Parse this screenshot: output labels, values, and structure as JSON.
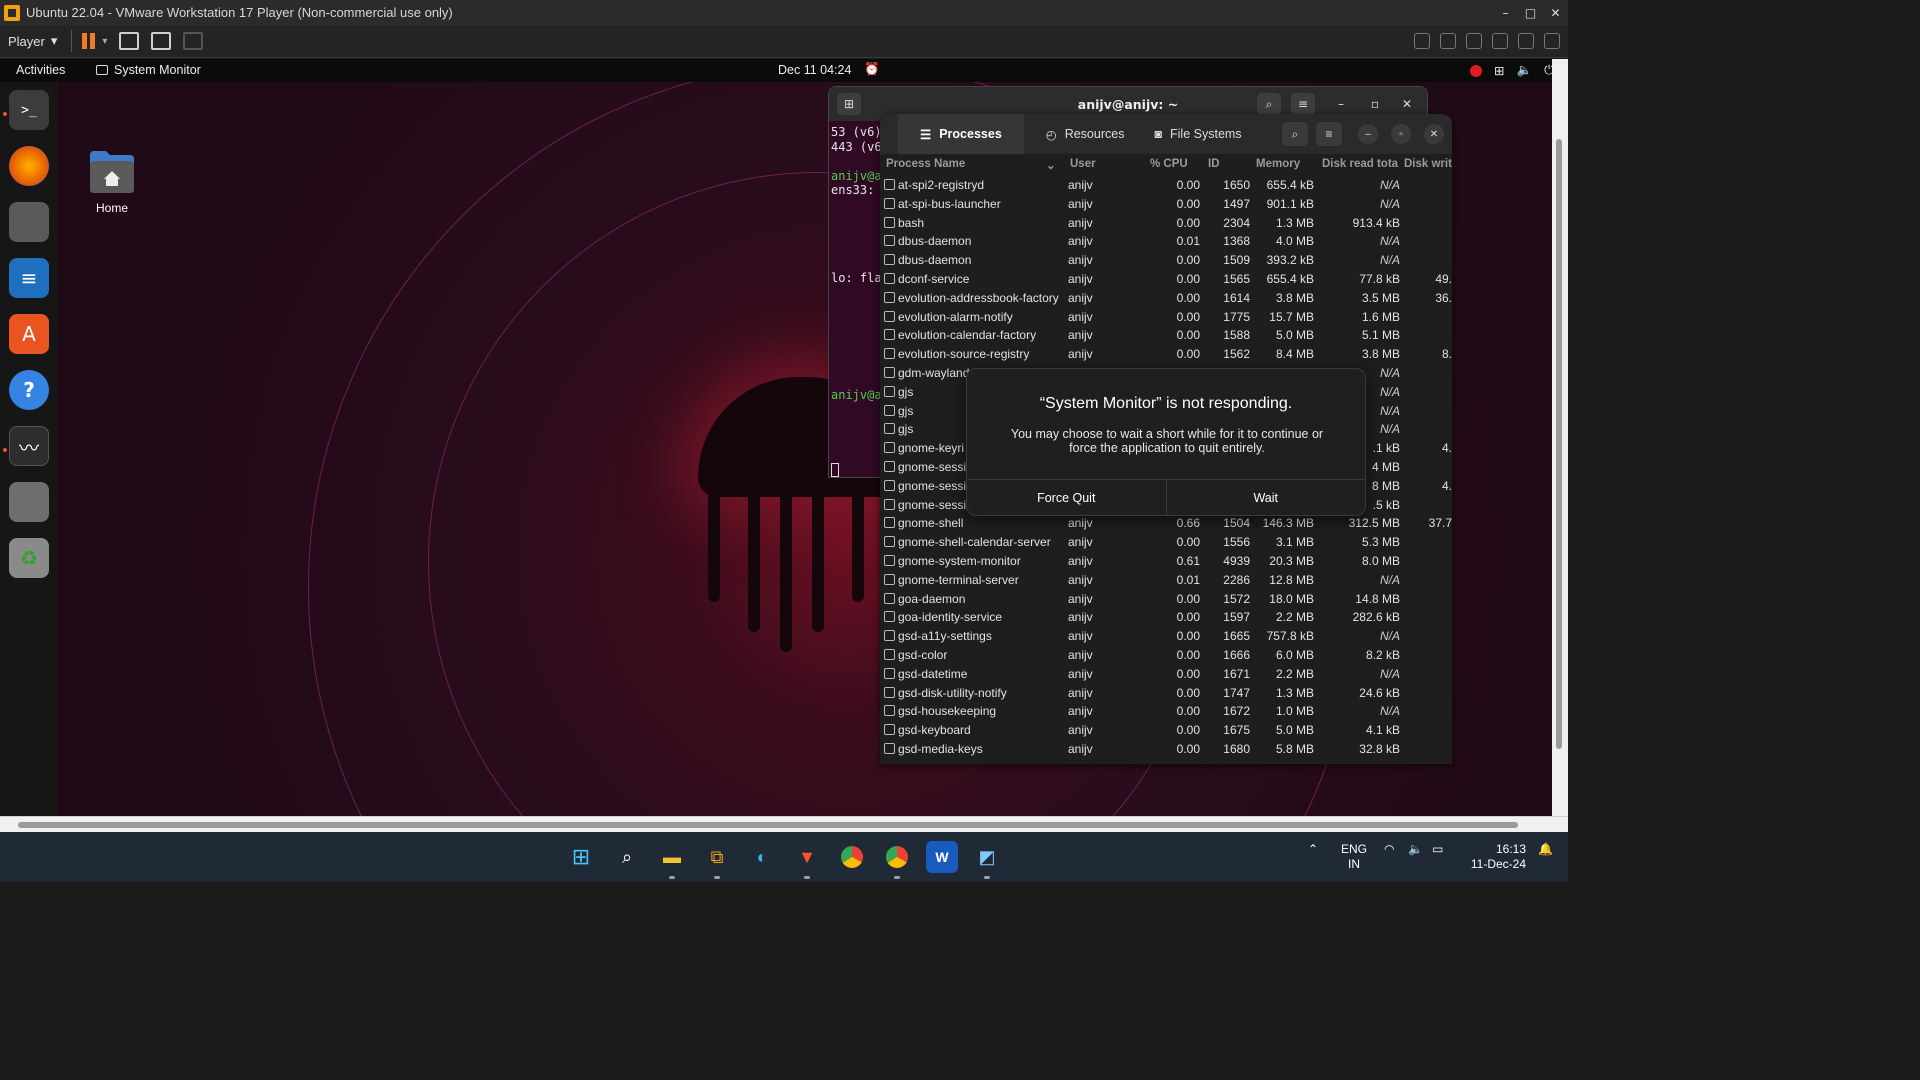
{
  "vmware": {
    "window_title": "Ubuntu 22.04 - VMware Workstation 17 Player (Non-commercial use only)",
    "player_menu": "Player",
    "window_controls": [
      "–",
      "□",
      "✕"
    ]
  },
  "ubuntu_topbar": {
    "activities": "Activities",
    "app_name": "System Monitor",
    "clock": "Dec 11  04:24"
  },
  "desktop": {
    "home_label": "Home"
  },
  "dock": {
    "items": [
      "terminal",
      "firefox",
      "files",
      "libreoffice-writer",
      "app-center",
      "help",
      "system-monitor",
      "show-apps",
      "trash"
    ]
  },
  "terminal": {
    "title": "anijv@anijv: ~",
    "lines": [
      "53 (v6)",
      "443 (v6",
      "",
      "anijv@a",
      "ens33:",
      "",
      "",
      "",
      "",
      "",
      "lo: fla",
      "",
      "",
      "",
      "",
      "",
      "",
      "",
      "anijv@a"
    ]
  },
  "system_monitor": {
    "tabs": [
      {
        "label": "Processes",
        "active": true
      },
      {
        "label": "Resources",
        "active": false
      },
      {
        "label": "File Systems",
        "active": false
      }
    ],
    "columns": [
      "Process Name",
      "User",
      "% CPU",
      "ID",
      "Memory",
      "Disk read tota",
      "Disk writ"
    ],
    "rows": [
      {
        "name": "at-spi2-registryd",
        "user": "anijv",
        "cpu": "0.00",
        "id": "1650",
        "mem": "655.4 kB",
        "read": "N/A",
        "write": ""
      },
      {
        "name": "at-spi-bus-launcher",
        "user": "anijv",
        "cpu": "0.00",
        "id": "1497",
        "mem": "901.1 kB",
        "read": "N/A",
        "write": ""
      },
      {
        "name": "bash",
        "user": "anijv",
        "cpu": "0.00",
        "id": "2304",
        "mem": "1.3 MB",
        "read": "913.4 kB",
        "write": ""
      },
      {
        "name": "dbus-daemon",
        "user": "anijv",
        "cpu": "0.01",
        "id": "1368",
        "mem": "4.0 MB",
        "read": "N/A",
        "write": ""
      },
      {
        "name": "dbus-daemon",
        "user": "anijv",
        "cpu": "0.00",
        "id": "1509",
        "mem": "393.2 kB",
        "read": "N/A",
        "write": ""
      },
      {
        "name": "dconf-service",
        "user": "anijv",
        "cpu": "0.00",
        "id": "1565",
        "mem": "655.4 kB",
        "read": "77.8 kB",
        "write": "49."
      },
      {
        "name": "evolution-addressbook-factory",
        "user": "anijv",
        "cpu": "0.00",
        "id": "1614",
        "mem": "3.8 MB",
        "read": "3.5 MB",
        "write": "36."
      },
      {
        "name": "evolution-alarm-notify",
        "user": "anijv",
        "cpu": "0.00",
        "id": "1775",
        "mem": "15.7 MB",
        "read": "1.6 MB",
        "write": ""
      },
      {
        "name": "evolution-calendar-factory",
        "user": "anijv",
        "cpu": "0.00",
        "id": "1588",
        "mem": "5.0 MB",
        "read": "5.1 MB",
        "write": ""
      },
      {
        "name": "evolution-source-registry",
        "user": "anijv",
        "cpu": "0.00",
        "id": "1562",
        "mem": "8.4 MB",
        "read": "3.8 MB",
        "write": "8."
      },
      {
        "name": "gdm-wayland",
        "user": "",
        "cpu": "",
        "id": "",
        "mem": "",
        "read": "N/A",
        "write": ""
      },
      {
        "name": "gjs",
        "user": "",
        "cpu": "",
        "id": "",
        "mem": "",
        "read": "N/A",
        "write": ""
      },
      {
        "name": "gjs",
        "user": "",
        "cpu": "",
        "id": "",
        "mem": "",
        "read": "N/A",
        "write": ""
      },
      {
        "name": "gjs",
        "user": "",
        "cpu": "",
        "id": "",
        "mem": "",
        "read": "N/A",
        "write": ""
      },
      {
        "name": "gnome-keyri",
        "user": "",
        "cpu": "",
        "id": "",
        "mem": "",
        "read": ".1 kB",
        "write": "4."
      },
      {
        "name": "gnome-sessi",
        "user": "",
        "cpu": "",
        "id": "",
        "mem": "",
        "read": "4 MB",
        "write": ""
      },
      {
        "name": "gnome-sessi",
        "user": "",
        "cpu": "",
        "id": "",
        "mem": "",
        "read": "8 MB",
        "write": "4."
      },
      {
        "name": "gnome-sessi",
        "user": "",
        "cpu": "",
        "id": "",
        "mem": "",
        "read": ".5 kB",
        "write": ""
      },
      {
        "name": "gnome-shell",
        "user": "anijv",
        "cpu": "0.66",
        "id": "1504",
        "mem": "146.3 MB",
        "read": "312.5 MB",
        "write": "37.7"
      },
      {
        "name": "gnome-shell-calendar-server",
        "user": "anijv",
        "cpu": "0.00",
        "id": "1556",
        "mem": "3.1 MB",
        "read": "5.3 MB",
        "write": ""
      },
      {
        "name": "gnome-system-monitor",
        "user": "anijv",
        "cpu": "0.61",
        "id": "4939",
        "mem": "20.3 MB",
        "read": "8.0 MB",
        "write": ""
      },
      {
        "name": "gnome-terminal-server",
        "user": "anijv",
        "cpu": "0.01",
        "id": "2286",
        "mem": "12.8 MB",
        "read": "N/A",
        "write": ""
      },
      {
        "name": "goa-daemon",
        "user": "anijv",
        "cpu": "0.00",
        "id": "1572",
        "mem": "18.0 MB",
        "read": "14.8 MB",
        "write": ""
      },
      {
        "name": "goa-identity-service",
        "user": "anijv",
        "cpu": "0.00",
        "id": "1597",
        "mem": "2.2 MB",
        "read": "282.6 kB",
        "write": ""
      },
      {
        "name": "gsd-a11y-settings",
        "user": "anijv",
        "cpu": "0.00",
        "id": "1665",
        "mem": "757.8 kB",
        "read": "N/A",
        "write": ""
      },
      {
        "name": "gsd-color",
        "user": "anijv",
        "cpu": "0.00",
        "id": "1666",
        "mem": "6.0 MB",
        "read": "8.2 kB",
        "write": ""
      },
      {
        "name": "gsd-datetime",
        "user": "anijv",
        "cpu": "0.00",
        "id": "1671",
        "mem": "2.2 MB",
        "read": "N/A",
        "write": ""
      },
      {
        "name": "gsd-disk-utility-notify",
        "user": "anijv",
        "cpu": "0.00",
        "id": "1747",
        "mem": "1.3 MB",
        "read": "24.6 kB",
        "write": ""
      },
      {
        "name": "gsd-housekeeping",
        "user": "anijv",
        "cpu": "0.00",
        "id": "1672",
        "mem": "1.0 MB",
        "read": "N/A",
        "write": ""
      },
      {
        "name": "gsd-keyboard",
        "user": "anijv",
        "cpu": "0.00",
        "id": "1675",
        "mem": "5.0 MB",
        "read": "4.1 kB",
        "write": ""
      },
      {
        "name": "gsd-media-keys",
        "user": "anijv",
        "cpu": "0.00",
        "id": "1680",
        "mem": "5.8 MB",
        "read": "32.8 kB",
        "write": ""
      }
    ]
  },
  "dialog": {
    "title": "“System Monitor” is not responding.",
    "body": "You may choose to wait a short while for it to continue or force the application to quit entirely.",
    "force_quit": "Force Quit",
    "wait": "Wait"
  },
  "taskbar": {
    "lang_top": "ENG",
    "lang_bottom": "IN",
    "time": "16:13",
    "date": "11-Dec-24"
  },
  "colors": {
    "ubuntu_orange": "#e95420",
    "desktop_bg": "#2a0c1c",
    "terminal_bg": "#300a24",
    "taskbar_bg": "#202a36"
  }
}
